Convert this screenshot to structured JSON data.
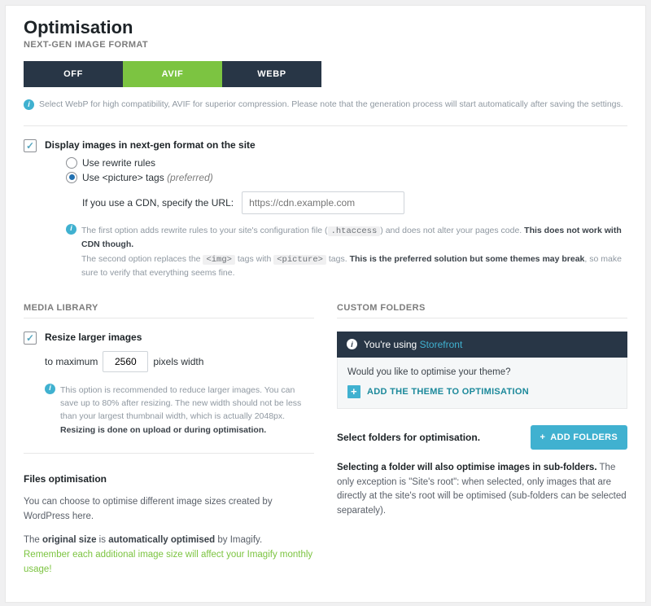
{
  "header": {
    "title": "Optimisation",
    "subheader": "NEXT-GEN IMAGE FORMAT"
  },
  "tabs": [
    "OFF",
    "AVIF",
    "WEBP"
  ],
  "info1": "Select WebP for high compatibility, AVIF for superior compression. Please note that the generation process will start automatically after saving the settings.",
  "display": {
    "title": "Display images in next-gen format on the site",
    "opt1": "Use rewrite rules",
    "opt2_a": "Use <picture> tags ",
    "opt2_b": "(preferred)",
    "cdn_label": "If you use a CDN, specify the URL:",
    "cdn_placeholder": "https://cdn.example.com",
    "note1_a": "The first option adds rewrite rules to your site's configuration file (",
    "note1_code": ".htaccess",
    "note1_b": ") and does not alter your pages code. ",
    "note1_bold": "This does not work with CDN though.",
    "note2_a": "The second option replaces the ",
    "note2_code1": "<img>",
    "note2_b": " tags with ",
    "note2_code2": "<picture>",
    "note2_c": " tags. ",
    "note2_bold": "This is the preferred solution but some themes may break",
    "note2_d": ", so make sure to verify that everything seems fine."
  },
  "media": {
    "header": "MEDIA LIBRARY",
    "resize_title": "Resize larger images",
    "resize_pre": "to maximum",
    "resize_value": "2560",
    "resize_post": "pixels width",
    "note_a": "This option is recommended to reduce larger images. You can save up to 80% after resizing. The new width should not be less than your largest thumbnail width, which is actually 2048px. ",
    "note_bold": "Resizing is done on upload or during optimisation.",
    "files_h": "Files optimisation",
    "files_l1": "You can choose to optimise different image sizes created by WordPress here.",
    "files_l2_a": "The ",
    "files_l2_b": "original size",
    "files_l2_c": " is ",
    "files_l2_d": "automatically optimised",
    "files_l2_e": " by Imagify.",
    "files_l3": "Remember each additional image size will affect your Imagify monthly usage!"
  },
  "custom": {
    "header": "CUSTOM FOLDERS",
    "banner_a": "You're using ",
    "banner_b": "Storefront",
    "panel_q": "Would you like to optimise your theme?",
    "panel_btn": "ADD THE THEME TO OPTIMISATION",
    "select_label": "Select folders for optimisation.",
    "add_btn": "ADD FOLDERS",
    "desc_bold1": "Selecting a folder will also optimise images in sub-folders.",
    "desc_a": " The only exception is \"Site's root\": when selected, only images that are directly at the site's root will be optimised (sub-folders can be selected separately)."
  }
}
